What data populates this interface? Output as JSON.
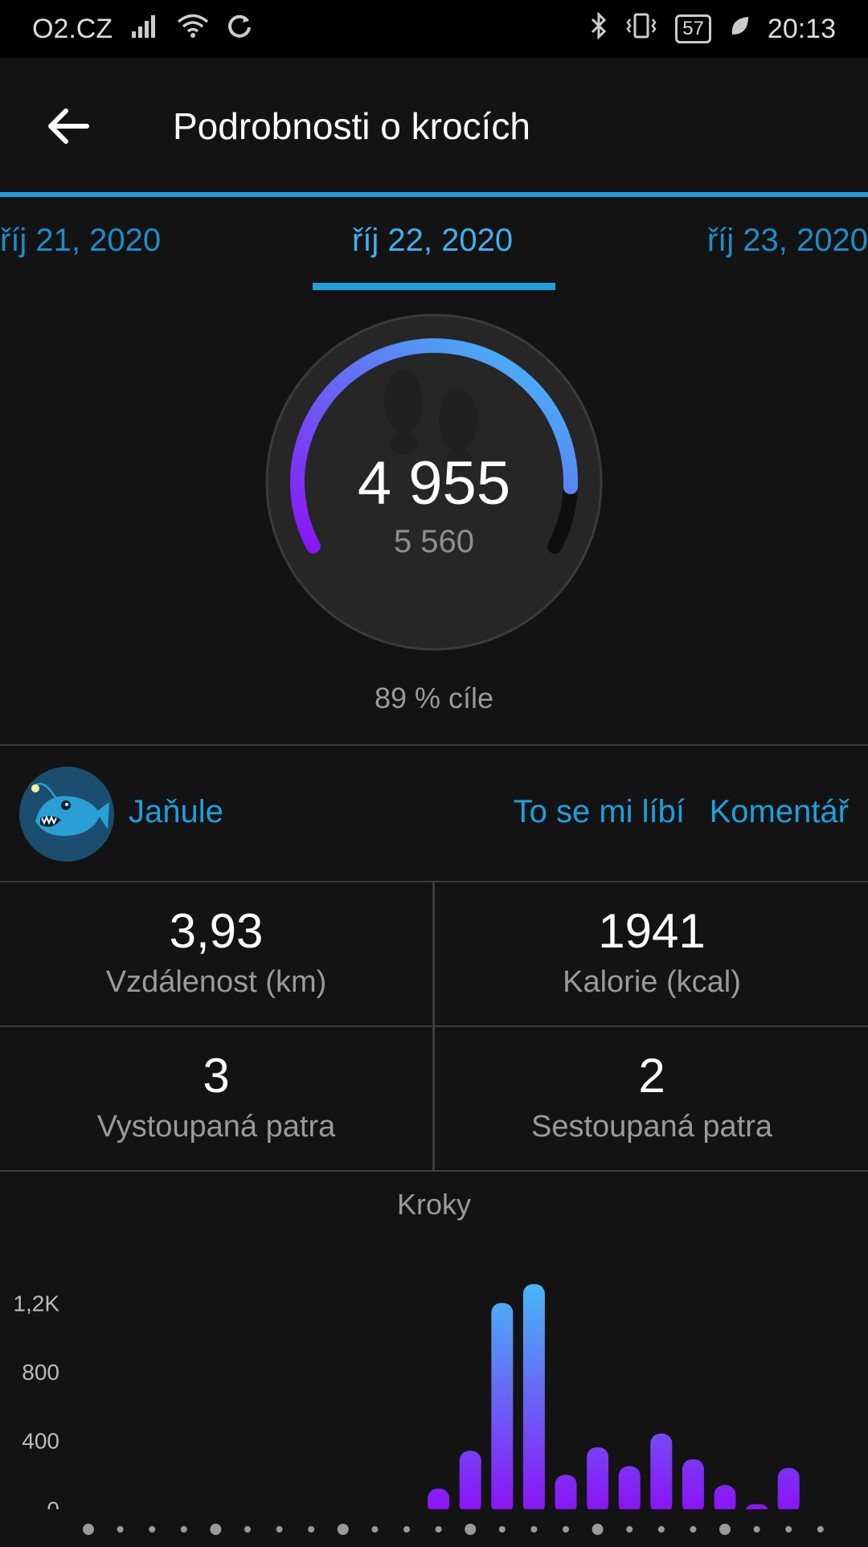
{
  "status_bar": {
    "carrier": "O2.CZ",
    "battery": "57",
    "time": "20:13",
    "icons": [
      "signal-icon",
      "wifi-icon",
      "sync-icon",
      "bluetooth-icon",
      "vibrate-icon",
      "battery-icon",
      "leaf-icon"
    ]
  },
  "header": {
    "title": "Podrobnosti o krocích"
  },
  "date_tabs": {
    "prev": "říj 21, 2020",
    "current": "říj 22, 2020",
    "next": "říj 23, 2020"
  },
  "summary": {
    "steps": "4 955",
    "goal": "5 560",
    "goal_percent_text": "89 % cíle",
    "progress_fraction": 0.89
  },
  "social": {
    "username": "Jaňule",
    "like_label": "To se mi líbí",
    "comment_label": "Komentář"
  },
  "stats": [
    {
      "value": "3,93",
      "label": "Vzdálenost (km)"
    },
    {
      "value": "1941",
      "label": "Kalorie (kcal)"
    },
    {
      "value": "3",
      "label": "Vystoupaná patra"
    },
    {
      "value": "2",
      "label": "Sestoupaná patra"
    }
  ],
  "colors": {
    "accent": "#1e9fdc",
    "bar_top": "#49b6f5",
    "bar_bottom": "#8a14f5",
    "ring_start": "#8a14f5",
    "ring_end": "#3fc5f5"
  },
  "chart_data": {
    "type": "bar",
    "title": "Kroky",
    "y_ticks": [
      "0",
      "400",
      "800",
      "1,2K"
    ],
    "ylim": [
      0,
      1300
    ],
    "slot_count": 24,
    "values": [
      0,
      0,
      0,
      0,
      0,
      0,
      0,
      0,
      0,
      0,
      0,
      120,
      340,
      1200,
      1310,
      200,
      360,
      250,
      440,
      290,
      140,
      30,
      240,
      0
    ]
  }
}
